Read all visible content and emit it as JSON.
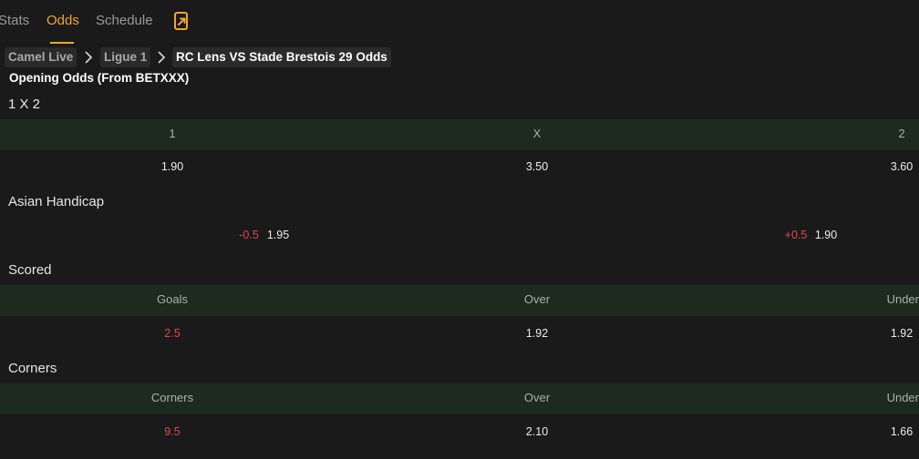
{
  "tabs": [
    {
      "label": "Stats"
    },
    {
      "label": "Odds"
    },
    {
      "label": "Schedule"
    }
  ],
  "breadcrumb": {
    "home": "Camel Live",
    "league": "Ligue 1",
    "current": "RC Lens VS Stade Brestois 29 Odds"
  },
  "source_label": "Opening Odds (From BETXXX)",
  "one_x_two": {
    "title": "1 X 2",
    "headers": [
      "1",
      "X",
      "2"
    ],
    "values": [
      "1.90",
      "3.50",
      "3.60"
    ]
  },
  "asian_handicap": {
    "title": "Asian Handicap",
    "home": {
      "line": "-0.5",
      "odds": "1.95"
    },
    "away": {
      "line": "+0.5",
      "odds": "1.90"
    }
  },
  "scored": {
    "title": "Scored",
    "headers": [
      "Goals",
      "Over",
      "Under"
    ],
    "values": [
      "2.5",
      "1.92",
      "1.92"
    ]
  },
  "corners": {
    "title": "Corners",
    "headers": [
      "Corners",
      "Over",
      "Under"
    ],
    "values": [
      "9.5",
      "2.10",
      "1.66"
    ]
  },
  "colors": {
    "accent": "#f0a62c",
    "background": "#1a1a1a",
    "header_row": "#1d2a1d",
    "negative": "#e34848"
  }
}
